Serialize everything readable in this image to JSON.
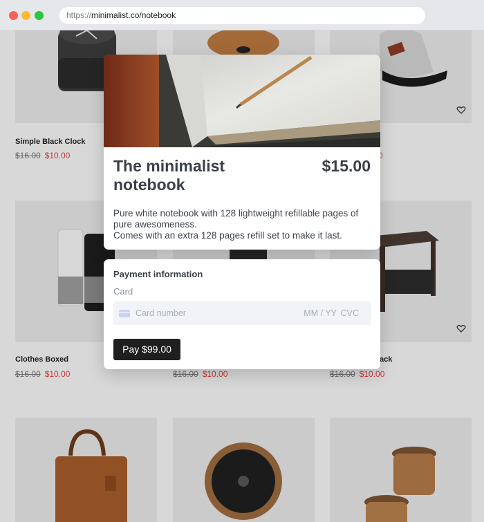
{
  "browser": {
    "url_protocol": "https://",
    "url_rest": "minimalist.co/notebook"
  },
  "products": [
    {
      "name": "Simple Black Clock",
      "old_price": "$16.00",
      "price": "$10.00"
    },
    {
      "name": "Clothes Boxed",
      "old_price": "$16.00",
      "price": "$10.00"
    },
    {
      "name_partial": "ack",
      "old_price": "$16.00",
      "price": "$10.00"
    },
    {
      "old_price": "$16.00",
      "price": "$10.00"
    },
    {
      "price_partial": "0"
    }
  ],
  "modal": {
    "title": "The minimalist notebook",
    "price": "$15.00",
    "description": "Pure white notebook with 128 lightweight refillable pages of pure awesomeness.\nComes with an extra 128 pages refill set to make it last."
  },
  "payment": {
    "title": "Payment information",
    "card_label": "Card",
    "card_number_placeholder": "Card number",
    "expiry_placeholder": "MM / YY",
    "cvc_placeholder": "CVC",
    "pay_button": "Pay $99.00"
  },
  "colors": {
    "sale_price": "#e0413b",
    "pay_button_bg": "#1f1f1f"
  }
}
